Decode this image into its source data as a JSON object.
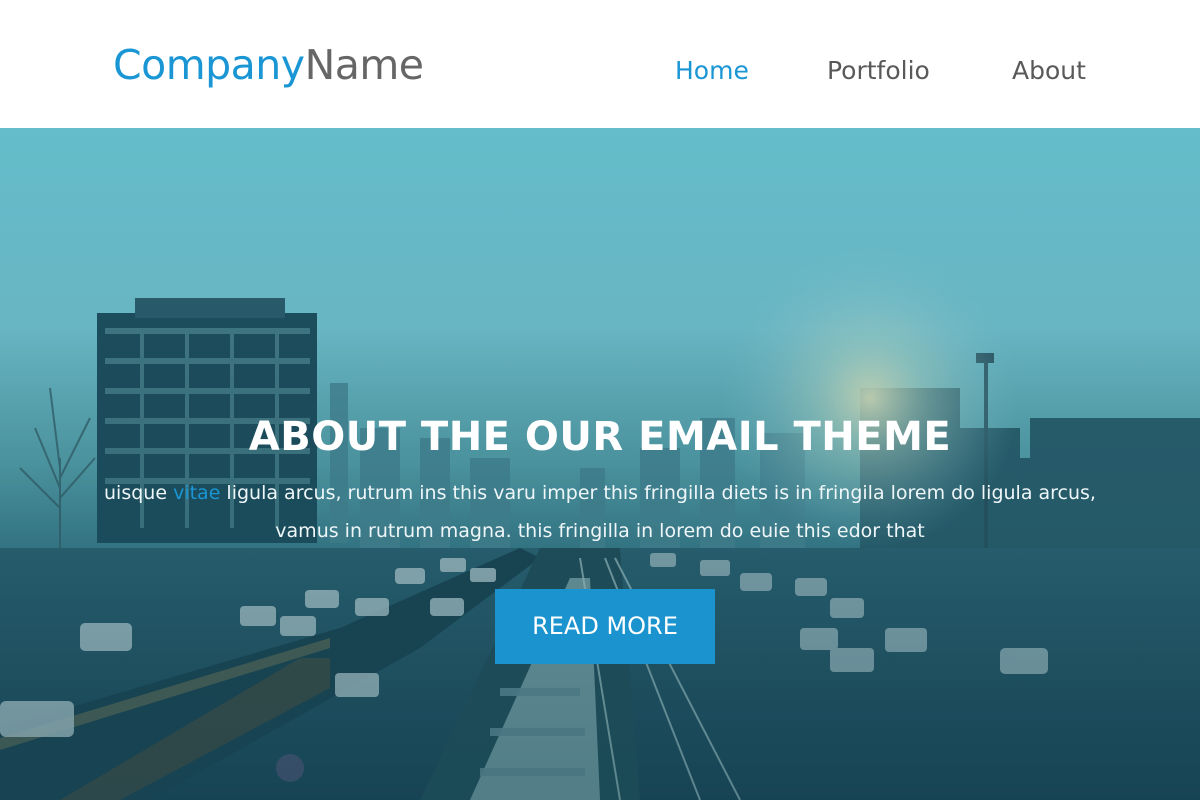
{
  "header": {
    "logo": {
      "part1": "Company",
      "part2": "Name"
    },
    "nav": [
      {
        "label": "Home",
        "active": true
      },
      {
        "label": "Portfolio",
        "active": false
      },
      {
        "label": "About",
        "active": false
      }
    ]
  },
  "hero": {
    "title": "ABOUT THE OUR EMAIL THEME",
    "text": {
      "before": "uisque ",
      "highlight": "vitae",
      "after": " ligula arcus, rutrum ins this varu imper this fringilla diets is in fringila lorem do ligula arcus, vamus in rutrum magna. this fringilla in lorem do euie this edor that"
    },
    "button_label": "READ MORE"
  },
  "colors": {
    "accent": "#1a96d4",
    "nav_text": "#595959",
    "logo_secondary": "#666666",
    "button_bg": "#1a93cf"
  }
}
